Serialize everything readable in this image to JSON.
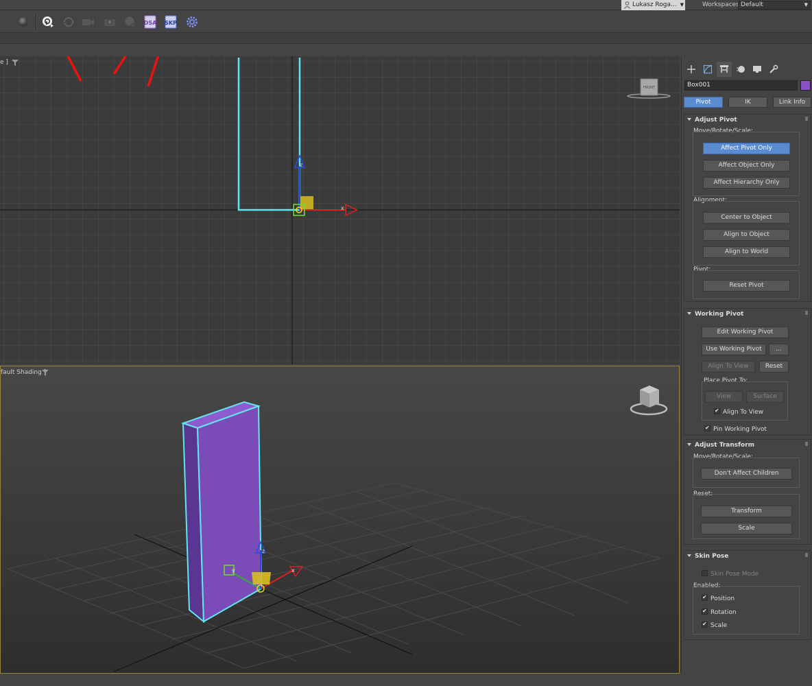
{
  "titlebar": {
    "user_name": "Lukasz Roga...",
    "workspaces_label": "Workspaces:",
    "workspace_value": "Default"
  },
  "toolbar": {
    "icons": [
      "render-sphere-icon",
      "render-play-icon",
      "render-refresh-icon",
      "camera-icon",
      "render-window-icon",
      "sphere-environment-icon",
      "dsa-export-icon",
      "skp-export-icon",
      "gear-icon"
    ],
    "dsa_label": "DSA",
    "skp_label": "SKP"
  },
  "viewports": {
    "front_label": "e ]",
    "persp_label": "fault Shading ]",
    "front_gizmo_label": "FRONT",
    "axis_x": "x",
    "axis_z": "z",
    "axis_y": "y"
  },
  "colors": {
    "accent": "#5a8ad0",
    "object": "#7b4bb8",
    "selection": "#62e6ee",
    "annotation": "#ee1111"
  },
  "command_panel": {
    "tabs": [
      "create-icon",
      "modify-icon",
      "hierarchy-icon",
      "motion-icon",
      "display-icon",
      "utilities-icon"
    ],
    "object_name": "Box001",
    "subtabs": [
      "Pivot",
      "IK",
      "Link Info"
    ],
    "adjust_pivot": {
      "title": "Adjust Pivot",
      "move_label": "Move/Rotate/Scale:",
      "affect_pivot": "Affect Pivot Only",
      "affect_object": "Affect Object Only",
      "affect_hierarchy": "Affect Hierarchy Only",
      "alignment_label": "Alignment:",
      "center_to_object": "Center to Object",
      "align_to_object": "Align to Object",
      "align_to_world": "Align to World",
      "pivot_label": "Pivot:",
      "reset_pivot": "Reset Pivot"
    },
    "working_pivot": {
      "title": "Working Pivot",
      "edit": "Edit Working Pivot",
      "use": "Use Working Pivot",
      "more": "...",
      "align_to_view": "Align To View",
      "reset": "Reset",
      "place_label": "Place Pivot To:",
      "view": "View",
      "surface": "Surface",
      "align_to_view_check": "Align To View",
      "pin": "Pin Working Pivot"
    },
    "adjust_transform": {
      "title": "Adjust Transform",
      "move_label": "Move/Rotate/Scale:",
      "dont_affect": "Don't Affect Children",
      "reset_label": "Reset:",
      "transform": "Transform",
      "scale": "Scale"
    },
    "skin_pose": {
      "title": "Skin Pose",
      "mode": "Skin Pose Mode",
      "enabled_label": "Enabled:",
      "position": "Position",
      "rotation": "Rotation",
      "scale": "Scale"
    }
  }
}
